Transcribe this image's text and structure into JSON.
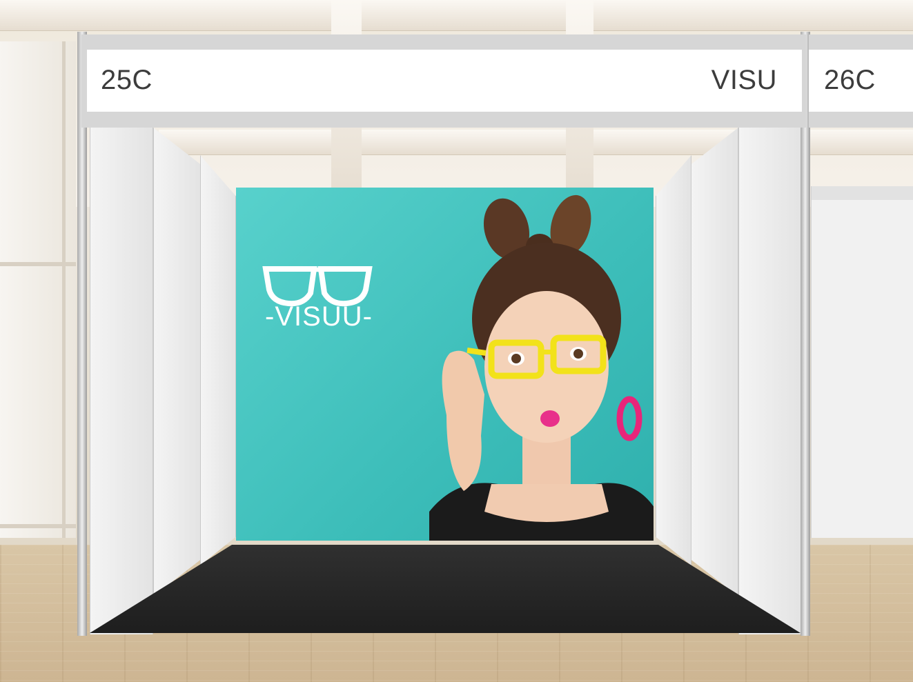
{
  "scene": {
    "description_free": true
  },
  "booth": {
    "left_label": "25C",
    "right_label": "VISU",
    "neighbor_label": "26C"
  },
  "banner": {
    "brand": "-VISUU-"
  },
  "colors": {
    "banner_teal": "#3cbdb9",
    "glasses_yellow": "#f2e21a",
    "earring_pink": "#e8257a",
    "booth_floor": "#262626"
  }
}
